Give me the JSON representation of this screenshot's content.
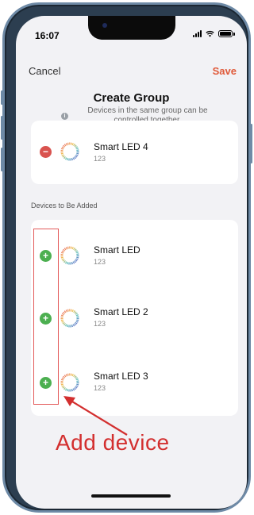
{
  "status_bar": {
    "time": "16:07"
  },
  "nav": {
    "cancel_label": "Cancel",
    "save_label": "Save"
  },
  "header": {
    "title": "Create Group",
    "subtitle": "Devices in the same group can be controlled together."
  },
  "current_devices": [
    {
      "name": "Smart LED 4",
      "sub": "123"
    }
  ],
  "section": {
    "label": "Devices to Be Added"
  },
  "devices_to_add": [
    {
      "name": "Smart LED",
      "sub": "123"
    },
    {
      "name": "Smart LED 2",
      "sub": "123"
    },
    {
      "name": "Smart LED 3",
      "sub": "123"
    }
  ],
  "annotation": {
    "text": "Add device"
  },
  "colors": {
    "accent": "#e05a3a",
    "add": "#4caf50",
    "remove": "#d9534f",
    "annotation": "#d32f2f"
  },
  "icons": {
    "remove": "minus-circle-icon",
    "add": "plus-circle-icon",
    "device": "smart-led-ring-icon",
    "info": "info-icon"
  }
}
